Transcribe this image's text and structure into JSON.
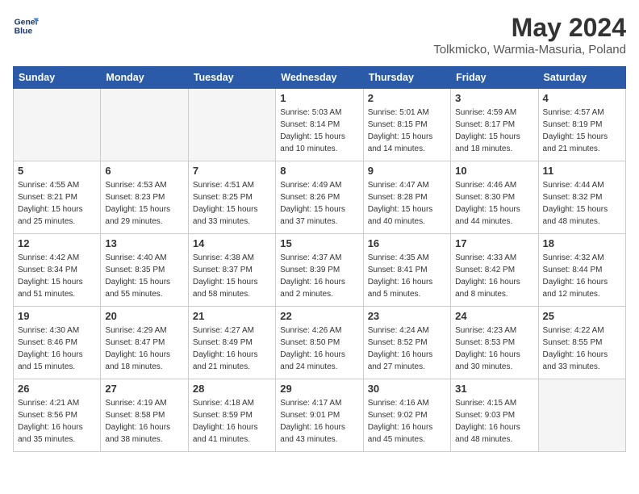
{
  "header": {
    "logo_line1": "General",
    "logo_line2": "Blue",
    "month": "May 2024",
    "location": "Tolkmicko, Warmia-Masuria, Poland"
  },
  "days_of_week": [
    "Sunday",
    "Monday",
    "Tuesday",
    "Wednesday",
    "Thursday",
    "Friday",
    "Saturday"
  ],
  "weeks": [
    [
      {
        "day": "",
        "empty": true
      },
      {
        "day": "",
        "empty": true
      },
      {
        "day": "",
        "empty": true
      },
      {
        "day": "1",
        "sunrise": "5:03 AM",
        "sunset": "8:14 PM",
        "daylight": "15 hours and 10 minutes."
      },
      {
        "day": "2",
        "sunrise": "5:01 AM",
        "sunset": "8:15 PM",
        "daylight": "15 hours and 14 minutes."
      },
      {
        "day": "3",
        "sunrise": "4:59 AM",
        "sunset": "8:17 PM",
        "daylight": "15 hours and 18 minutes."
      },
      {
        "day": "4",
        "sunrise": "4:57 AM",
        "sunset": "8:19 PM",
        "daylight": "15 hours and 21 minutes."
      }
    ],
    [
      {
        "day": "5",
        "sunrise": "4:55 AM",
        "sunset": "8:21 PM",
        "daylight": "15 hours and 25 minutes."
      },
      {
        "day": "6",
        "sunrise": "4:53 AM",
        "sunset": "8:23 PM",
        "daylight": "15 hours and 29 minutes."
      },
      {
        "day": "7",
        "sunrise": "4:51 AM",
        "sunset": "8:25 PM",
        "daylight": "15 hours and 33 minutes."
      },
      {
        "day": "8",
        "sunrise": "4:49 AM",
        "sunset": "8:26 PM",
        "daylight": "15 hours and 37 minutes."
      },
      {
        "day": "9",
        "sunrise": "4:47 AM",
        "sunset": "8:28 PM",
        "daylight": "15 hours and 40 minutes."
      },
      {
        "day": "10",
        "sunrise": "4:46 AM",
        "sunset": "8:30 PM",
        "daylight": "15 hours and 44 minutes."
      },
      {
        "day": "11",
        "sunrise": "4:44 AM",
        "sunset": "8:32 PM",
        "daylight": "15 hours and 48 minutes."
      }
    ],
    [
      {
        "day": "12",
        "sunrise": "4:42 AM",
        "sunset": "8:34 PM",
        "daylight": "15 hours and 51 minutes."
      },
      {
        "day": "13",
        "sunrise": "4:40 AM",
        "sunset": "8:35 PM",
        "daylight": "15 hours and 55 minutes."
      },
      {
        "day": "14",
        "sunrise": "4:38 AM",
        "sunset": "8:37 PM",
        "daylight": "15 hours and 58 minutes."
      },
      {
        "day": "15",
        "sunrise": "4:37 AM",
        "sunset": "8:39 PM",
        "daylight": "16 hours and 2 minutes."
      },
      {
        "day": "16",
        "sunrise": "4:35 AM",
        "sunset": "8:41 PM",
        "daylight": "16 hours and 5 minutes."
      },
      {
        "day": "17",
        "sunrise": "4:33 AM",
        "sunset": "8:42 PM",
        "daylight": "16 hours and 8 minutes."
      },
      {
        "day": "18",
        "sunrise": "4:32 AM",
        "sunset": "8:44 PM",
        "daylight": "16 hours and 12 minutes."
      }
    ],
    [
      {
        "day": "19",
        "sunrise": "4:30 AM",
        "sunset": "8:46 PM",
        "daylight": "16 hours and 15 minutes."
      },
      {
        "day": "20",
        "sunrise": "4:29 AM",
        "sunset": "8:47 PM",
        "daylight": "16 hours and 18 minutes."
      },
      {
        "day": "21",
        "sunrise": "4:27 AM",
        "sunset": "8:49 PM",
        "daylight": "16 hours and 21 minutes."
      },
      {
        "day": "22",
        "sunrise": "4:26 AM",
        "sunset": "8:50 PM",
        "daylight": "16 hours and 24 minutes."
      },
      {
        "day": "23",
        "sunrise": "4:24 AM",
        "sunset": "8:52 PM",
        "daylight": "16 hours and 27 minutes."
      },
      {
        "day": "24",
        "sunrise": "4:23 AM",
        "sunset": "8:53 PM",
        "daylight": "16 hours and 30 minutes."
      },
      {
        "day": "25",
        "sunrise": "4:22 AM",
        "sunset": "8:55 PM",
        "daylight": "16 hours and 33 minutes."
      }
    ],
    [
      {
        "day": "26",
        "sunrise": "4:21 AM",
        "sunset": "8:56 PM",
        "daylight": "16 hours and 35 minutes."
      },
      {
        "day": "27",
        "sunrise": "4:19 AM",
        "sunset": "8:58 PM",
        "daylight": "16 hours and 38 minutes."
      },
      {
        "day": "28",
        "sunrise": "4:18 AM",
        "sunset": "8:59 PM",
        "daylight": "16 hours and 41 minutes."
      },
      {
        "day": "29",
        "sunrise": "4:17 AM",
        "sunset": "9:01 PM",
        "daylight": "16 hours and 43 minutes."
      },
      {
        "day": "30",
        "sunrise": "4:16 AM",
        "sunset": "9:02 PM",
        "daylight": "16 hours and 45 minutes."
      },
      {
        "day": "31",
        "sunrise": "4:15 AM",
        "sunset": "9:03 PM",
        "daylight": "16 hours and 48 minutes."
      },
      {
        "day": "",
        "empty": true
      }
    ]
  ]
}
